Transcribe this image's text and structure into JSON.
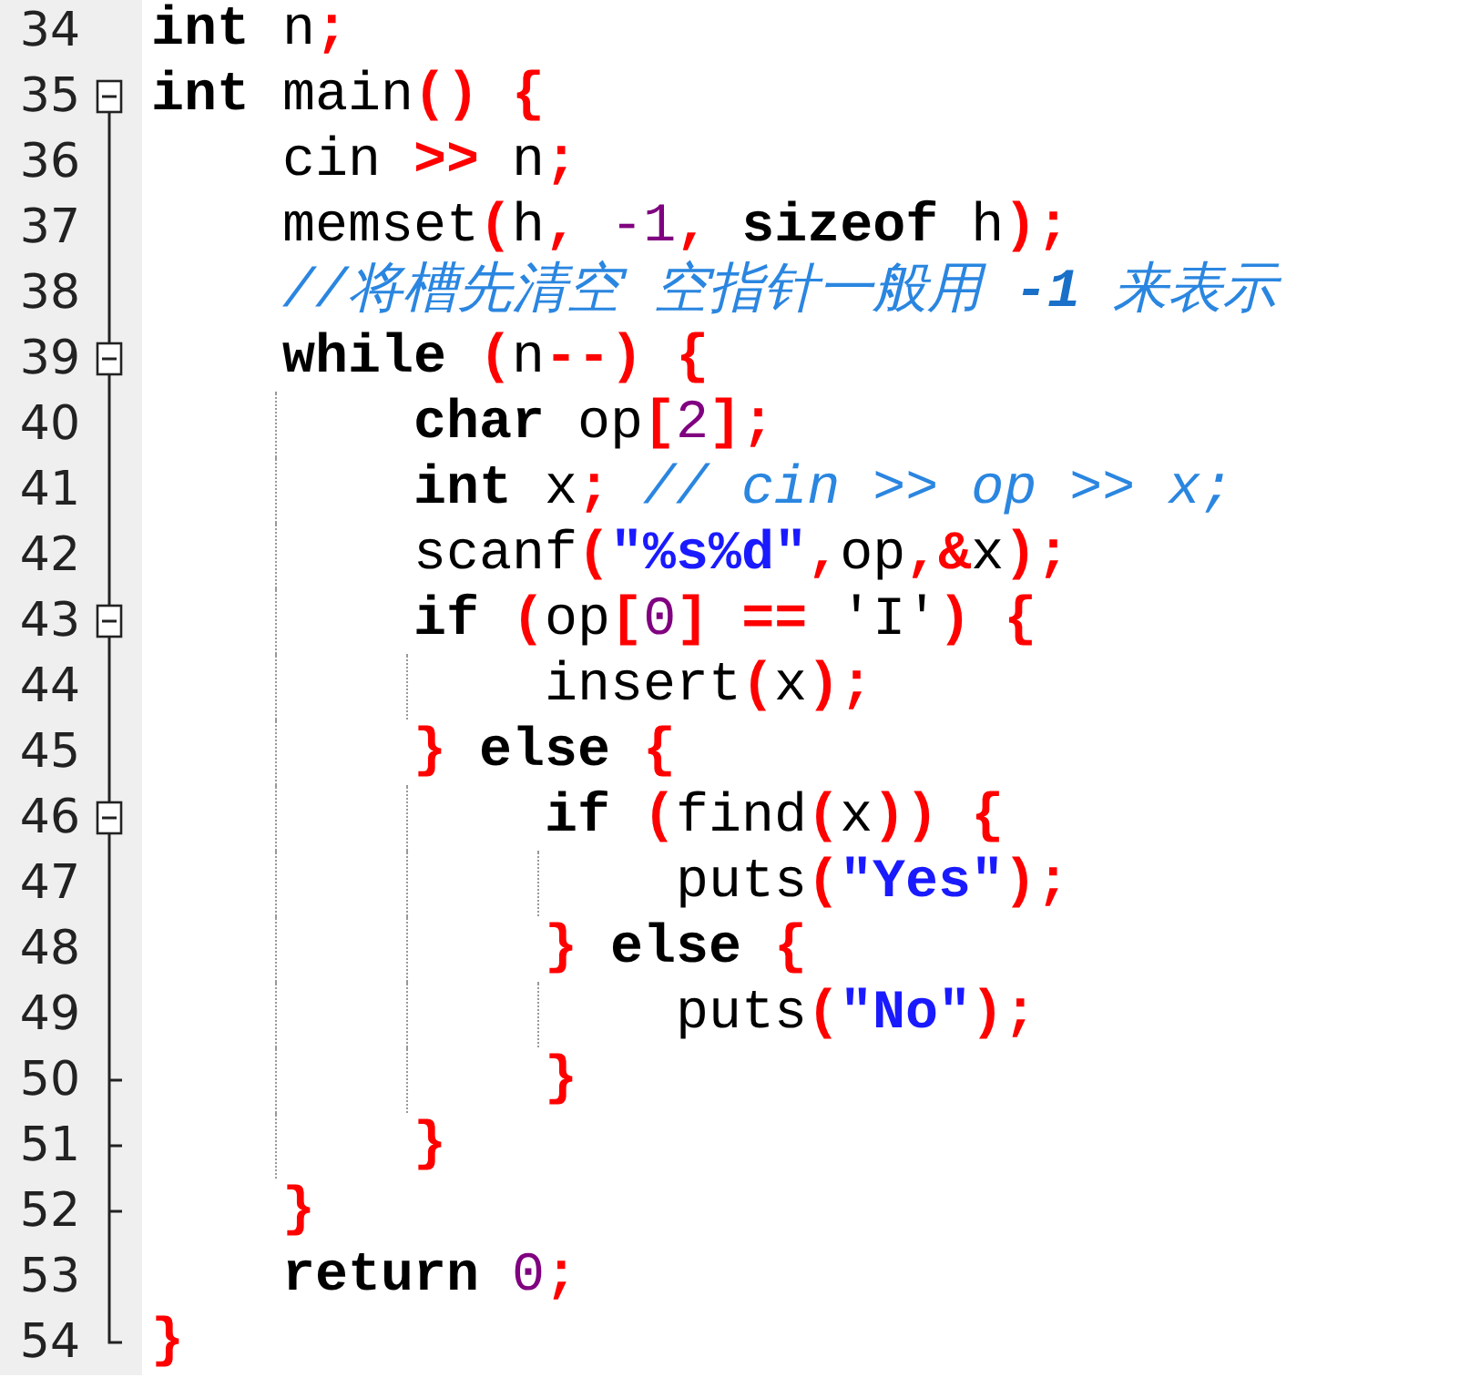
{
  "editor": {
    "lines": [
      {
        "number": "34",
        "kind": "plain",
        "tokens": [
          {
            "kind": "keyword",
            "text": "int"
          },
          {
            "kind": "plain",
            "text": " n"
          },
          {
            "kind": "operator",
            "text": ";"
          }
        ]
      },
      {
        "number": "35",
        "kind": "open",
        "tokens": [
          {
            "kind": "keyword",
            "text": "int"
          },
          {
            "kind": "plain",
            "text": " main"
          },
          {
            "kind": "operator",
            "text": "()"
          },
          {
            "kind": "operator",
            "text": " {"
          }
        ]
      },
      {
        "number": "36",
        "kind": "body",
        "tokens": [
          {
            "kind": "plain",
            "text": "    cin"
          },
          {
            "kind": "operator",
            "text": " >>"
          },
          {
            "kind": "plain",
            "text": " n"
          },
          {
            "kind": "operator",
            "text": ";"
          }
        ]
      },
      {
        "number": "37",
        "kind": "body",
        "tokens": [
          {
            "kind": "plain",
            "text": "    memset"
          },
          {
            "kind": "operator",
            "text": "("
          },
          {
            "kind": "plain",
            "text": "h"
          },
          {
            "kind": "operator",
            "text": ","
          },
          {
            "kind": "number",
            "text": " -1"
          },
          {
            "kind": "operator",
            "text": ","
          },
          {
            "kind": "keyword",
            "text": " sizeof"
          },
          {
            "kind": "plain",
            "text": " h"
          },
          {
            "kind": "operator",
            "text": ");"
          }
        ]
      },
      {
        "number": "38",
        "kind": "body",
        "tokens": [
          {
            "kind": "comment",
            "text": "    //将槽先清空 空指针一般用 **-1** 来表示"
          }
        ]
      },
      {
        "number": "39",
        "kind": "open",
        "tokens": [
          {
            "kind": "keyword",
            "text": "    while"
          },
          {
            "kind": "operator",
            "text": " ("
          },
          {
            "kind": "plain",
            "text": "n"
          },
          {
            "kind": "operator",
            "text": "--)"
          },
          {
            "kind": "operator",
            "text": " {"
          }
        ]
      },
      {
        "number": "40",
        "kind": "body",
        "tokens": [
          {
            "kind": "keyword",
            "text": "        char"
          },
          {
            "kind": "plain",
            "text": " op"
          },
          {
            "kind": "operator",
            "text": "["
          },
          {
            "kind": "number",
            "text": "2"
          },
          {
            "kind": "operator",
            "text": "];"
          }
        ]
      },
      {
        "number": "41",
        "kind": "body",
        "tokens": [
          {
            "kind": "keyword",
            "text": "        int"
          },
          {
            "kind": "plain",
            "text": " x"
          },
          {
            "kind": "operator",
            "text": ";"
          },
          {
            "kind": "comment",
            "text": " // cin >> op >> x;"
          }
        ]
      },
      {
        "number": "42",
        "kind": "body",
        "tokens": [
          {
            "kind": "plain",
            "text": "        scanf"
          },
          {
            "kind": "operator",
            "text": "("
          },
          {
            "kind": "string",
            "text": "\"%s%d\""
          },
          {
            "kind": "operator",
            "text": ","
          },
          {
            "kind": "plain",
            "text": "op"
          },
          {
            "kind": "operator",
            "text": ",&"
          },
          {
            "kind": "plain",
            "text": "x"
          },
          {
            "kind": "operator",
            "text": ");"
          }
        ]
      },
      {
        "number": "43",
        "kind": "open",
        "tokens": [
          {
            "kind": "keyword",
            "text": "        if"
          },
          {
            "kind": "operator",
            "text": " ("
          },
          {
            "kind": "plain",
            "text": "op"
          },
          {
            "kind": "operator",
            "text": "["
          },
          {
            "kind": "number",
            "text": "0"
          },
          {
            "kind": "operator",
            "text": "]"
          },
          {
            "kind": "operator",
            "text": " =="
          },
          {
            "kind": "plain",
            "text": " 'I'"
          },
          {
            "kind": "operator",
            "text": ")"
          },
          {
            "kind": "operator",
            "text": " {"
          }
        ]
      },
      {
        "number": "44",
        "kind": "body",
        "tokens": [
          {
            "kind": "plain",
            "text": "            insert"
          },
          {
            "kind": "operator",
            "text": "("
          },
          {
            "kind": "plain",
            "text": "x"
          },
          {
            "kind": "operator",
            "text": ");"
          }
        ]
      },
      {
        "number": "45",
        "kind": "body",
        "tokens": [
          {
            "kind": "operator",
            "text": "        }"
          },
          {
            "kind": "keyword",
            "text": " else"
          },
          {
            "kind": "operator",
            "text": " {"
          }
        ]
      },
      {
        "number": "46",
        "kind": "open",
        "tokens": [
          {
            "kind": "keyword",
            "text": "            if"
          },
          {
            "kind": "operator",
            "text": " ("
          },
          {
            "kind": "plain",
            "text": "find"
          },
          {
            "kind": "operator",
            "text": "("
          },
          {
            "kind": "plain",
            "text": "x"
          },
          {
            "kind": "operator",
            "text": "))"
          },
          {
            "kind": "operator",
            "text": " {"
          }
        ]
      },
      {
        "number": "47",
        "kind": "body",
        "tokens": [
          {
            "kind": "plain",
            "text": "                puts"
          },
          {
            "kind": "operator",
            "text": "("
          },
          {
            "kind": "string",
            "text": "\"Yes\""
          },
          {
            "kind": "operator",
            "text": ");"
          }
        ]
      },
      {
        "number": "48",
        "kind": "body",
        "tokens": [
          {
            "kind": "operator",
            "text": "            }"
          },
          {
            "kind": "keyword",
            "text": " else"
          },
          {
            "kind": "operator",
            "text": " {"
          }
        ]
      },
      {
        "number": "49",
        "kind": "body",
        "tokens": [
          {
            "kind": "plain",
            "text": "                puts"
          },
          {
            "kind": "operator",
            "text": "("
          },
          {
            "kind": "string",
            "text": "\"No\""
          },
          {
            "kind": "operator",
            "text": ");"
          }
        ]
      },
      {
        "number": "50",
        "kind": "inner-close",
        "tokens": [
          {
            "kind": "operator",
            "text": "            }"
          }
        ]
      },
      {
        "number": "51",
        "kind": "inner-close",
        "tokens": [
          {
            "kind": "operator",
            "text": "        }"
          }
        ]
      },
      {
        "number": "52",
        "kind": "inner-close",
        "tokens": [
          {
            "kind": "operator",
            "text": "    }"
          }
        ]
      },
      {
        "number": "53",
        "kind": "body",
        "tokens": [
          {
            "kind": "keyword",
            "text": "    return"
          },
          {
            "kind": "number",
            "text": " 0"
          },
          {
            "kind": "operator",
            "text": ";"
          }
        ]
      },
      {
        "number": "54",
        "kind": "close",
        "tokens": [
          {
            "kind": "operator",
            "text": "}"
          }
        ]
      }
    ]
  }
}
